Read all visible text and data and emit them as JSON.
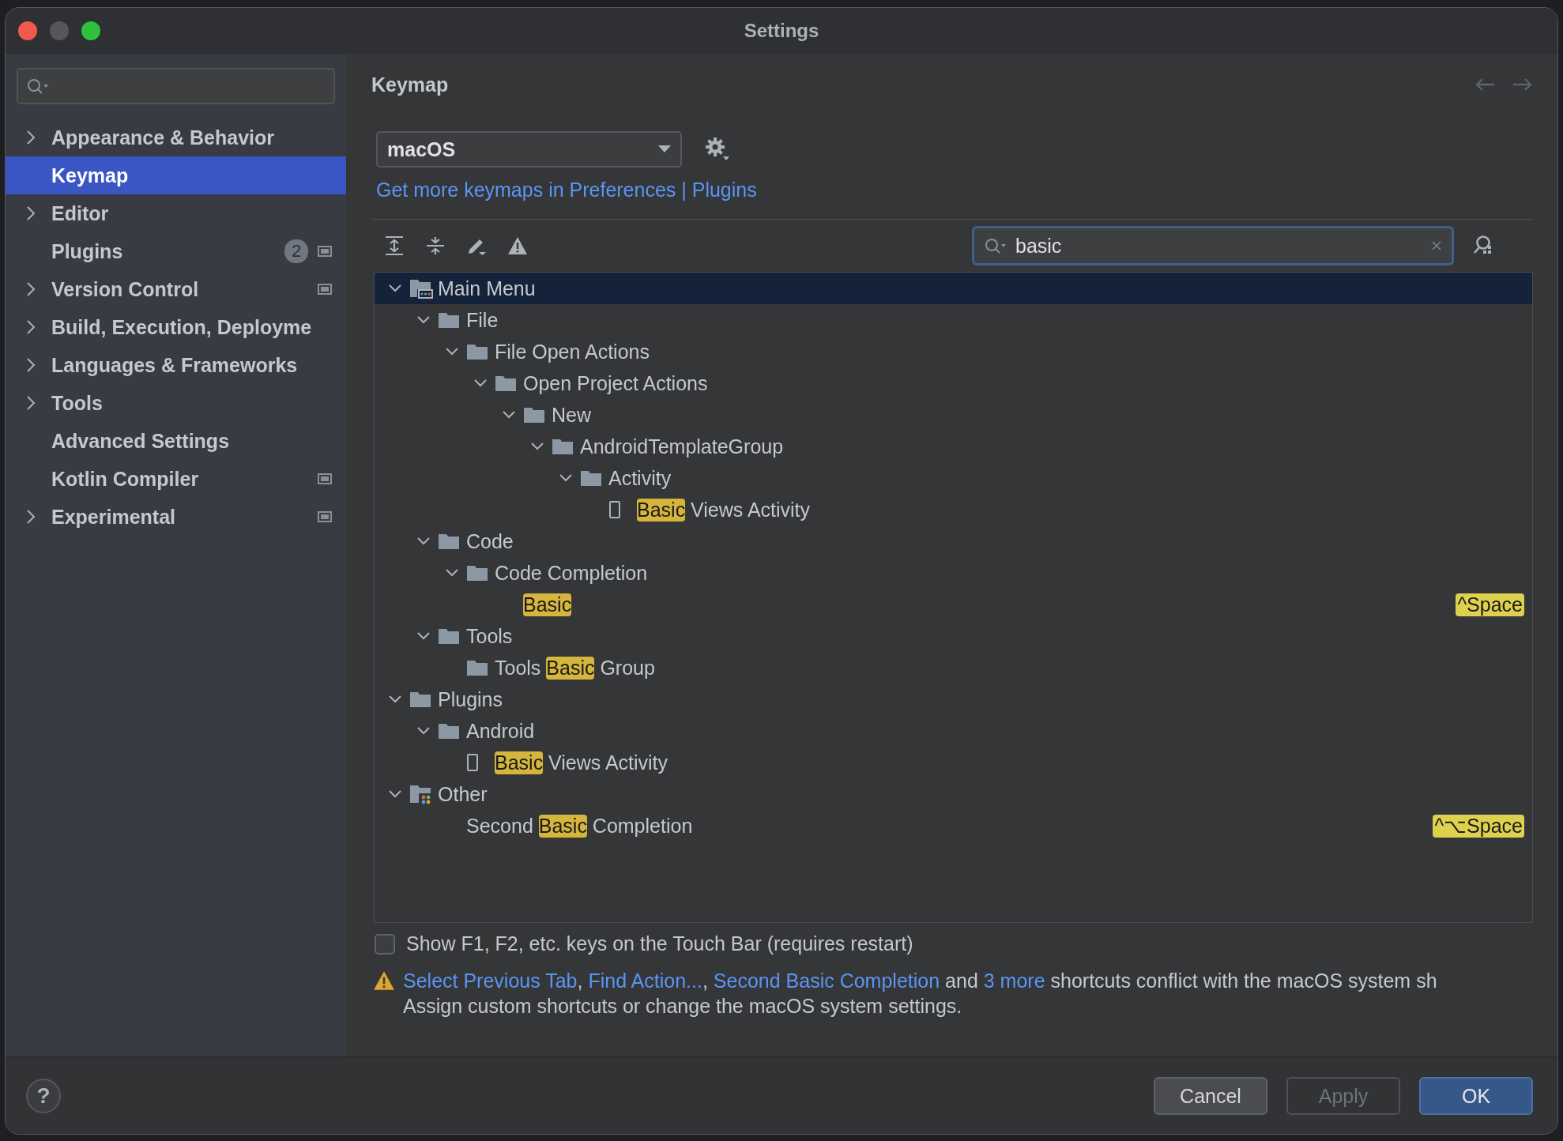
{
  "window": {
    "title": "Settings"
  },
  "sidebar": {
    "items": [
      {
        "label": "Appearance & Behavior",
        "expandable": true,
        "selected": false,
        "project_scope": false
      },
      {
        "label": "Keymap",
        "expandable": false,
        "selected": true,
        "project_scope": false
      },
      {
        "label": "Editor",
        "expandable": true,
        "selected": false,
        "project_scope": false
      },
      {
        "label": "Plugins",
        "expandable": false,
        "selected": false,
        "badge": "2",
        "project_scope": true
      },
      {
        "label": "Version Control",
        "expandable": true,
        "selected": false,
        "project_scope": true
      },
      {
        "label": "Build, Execution, Deployme",
        "expandable": true,
        "selected": false,
        "project_scope": false
      },
      {
        "label": "Languages & Frameworks",
        "expandable": true,
        "selected": false,
        "project_scope": false
      },
      {
        "label": "Tools",
        "expandable": true,
        "selected": false,
        "project_scope": false
      },
      {
        "label": "Advanced Settings",
        "expandable": false,
        "selected": false,
        "project_scope": false
      },
      {
        "label": "Kotlin Compiler",
        "expandable": false,
        "selected": false,
        "project_scope": true
      },
      {
        "label": "Experimental",
        "expandable": true,
        "selected": false,
        "project_scope": true
      }
    ]
  },
  "page": {
    "title": "Keymap",
    "keymap": "macOS",
    "more_link": "Get more keymaps in Preferences | Plugins",
    "search": {
      "value": "basic"
    }
  },
  "tree": [
    {
      "kind": "main_menu",
      "expanded": true,
      "selected": true,
      "parts": [
        {
          "text": "Main Menu",
          "match": false
        }
      ],
      "children": [
        {
          "kind": "folder",
          "expanded": true,
          "selected": false,
          "parts": [
            {
              "text": "File",
              "match": false
            }
          ],
          "children": [
            {
              "kind": "folder",
              "expanded": true,
              "selected": false,
              "parts": [
                {
                  "text": "File Open Actions",
                  "match": false
                }
              ],
              "children": [
                {
                  "kind": "folder",
                  "expanded": true,
                  "selected": false,
                  "parts": [
                    {
                      "text": "Open Project Actions",
                      "match": false
                    }
                  ],
                  "children": [
                    {
                      "kind": "folder",
                      "expanded": true,
                      "selected": false,
                      "parts": [
                        {
                          "text": "New",
                          "match": false
                        }
                      ],
                      "children": [
                        {
                          "kind": "folder",
                          "expanded": true,
                          "selected": false,
                          "parts": [
                            {
                              "text": "AndroidTemplateGroup",
                              "match": false
                            }
                          ],
                          "children": [
                            {
                              "kind": "folder",
                              "expanded": true,
                              "selected": false,
                              "parts": [
                                {
                                  "text": "Activity",
                                  "match": false
                                }
                              ],
                              "children": [
                                {
                                  "kind": "device_action",
                                  "selected": false,
                                  "parts": [
                                    {
                                      "text": "Basic",
                                      "match": true
                                    },
                                    {
                                      "text": " Views Activity",
                                      "match": false
                                    }
                                  ]
                                }
                              ]
                            }
                          ]
                        }
                      ]
                    }
                  ]
                }
              ]
            }
          ]
        },
        {
          "kind": "folder",
          "expanded": true,
          "selected": false,
          "parts": [
            {
              "text": "Code",
              "match": false
            }
          ],
          "children": [
            {
              "kind": "folder",
              "expanded": true,
              "selected": false,
              "parts": [
                {
                  "text": "Code Completion",
                  "match": false
                }
              ],
              "children": [
                {
                  "kind": "action",
                  "selected": false,
                  "parts": [
                    {
                      "text": "Basic",
                      "match": true
                    }
                  ],
                  "shortcut": "^Space"
                }
              ]
            }
          ]
        },
        {
          "kind": "folder",
          "expanded": true,
          "selected": false,
          "parts": [
            {
              "text": "Tools",
              "match": false
            }
          ],
          "children": [
            {
              "kind": "folder",
              "selected": false,
              "parts": [
                {
                  "text": "Tools ",
                  "match": false
                },
                {
                  "text": "Basic",
                  "match": true
                },
                {
                  "text": " Group",
                  "match": false
                }
              ]
            }
          ]
        }
      ]
    },
    {
      "kind": "folder",
      "expanded": true,
      "selected": false,
      "parts": [
        {
          "text": "Plugins",
          "match": false
        }
      ],
      "children": [
        {
          "kind": "folder",
          "expanded": true,
          "selected": false,
          "parts": [
            {
              "text": "Android",
              "match": false
            }
          ],
          "children": [
            {
              "kind": "device_action",
              "selected": false,
              "parts": [
                {
                  "text": "Basic",
                  "match": true
                },
                {
                  "text": " Views Activity",
                  "match": false
                }
              ]
            }
          ]
        }
      ]
    },
    {
      "kind": "other_group",
      "expanded": true,
      "selected": false,
      "parts": [
        {
          "text": "Other",
          "match": false
        }
      ],
      "children": [
        {
          "kind": "action",
          "selected": false,
          "parts": [
            {
              "text": "Second ",
              "match": false
            },
            {
              "text": "Basic",
              "match": true
            },
            {
              "text": " Completion",
              "match": false
            }
          ],
          "shortcut": "^⌥Space"
        }
      ]
    }
  ],
  "touch_bar": {
    "label": "Show F1, F2, etc. keys on the Touch Bar (requires restart)",
    "checked": false
  },
  "conflict": {
    "parts": [
      {
        "kind": "link",
        "text": "Select Previous Tab"
      },
      {
        "kind": "text",
        "text": ", "
      },
      {
        "kind": "link",
        "text": "Find Action..."
      },
      {
        "kind": "text",
        "text": ", "
      },
      {
        "kind": "link",
        "text": "Second Basic Completion"
      },
      {
        "kind": "text",
        "text": " and "
      },
      {
        "kind": "link",
        "text": "3 more"
      },
      {
        "kind": "text",
        "text": " shortcuts conflict with the macOS system sh"
      }
    ],
    "hint": "Assign custom shortcuts or change the macOS system settings."
  },
  "buttons": [
    {
      "label": "Cancel",
      "kind": "normal"
    },
    {
      "label": "Apply",
      "kind": "disabled"
    },
    {
      "label": "OK",
      "kind": "default"
    }
  ],
  "help": {
    "label": "?"
  }
}
